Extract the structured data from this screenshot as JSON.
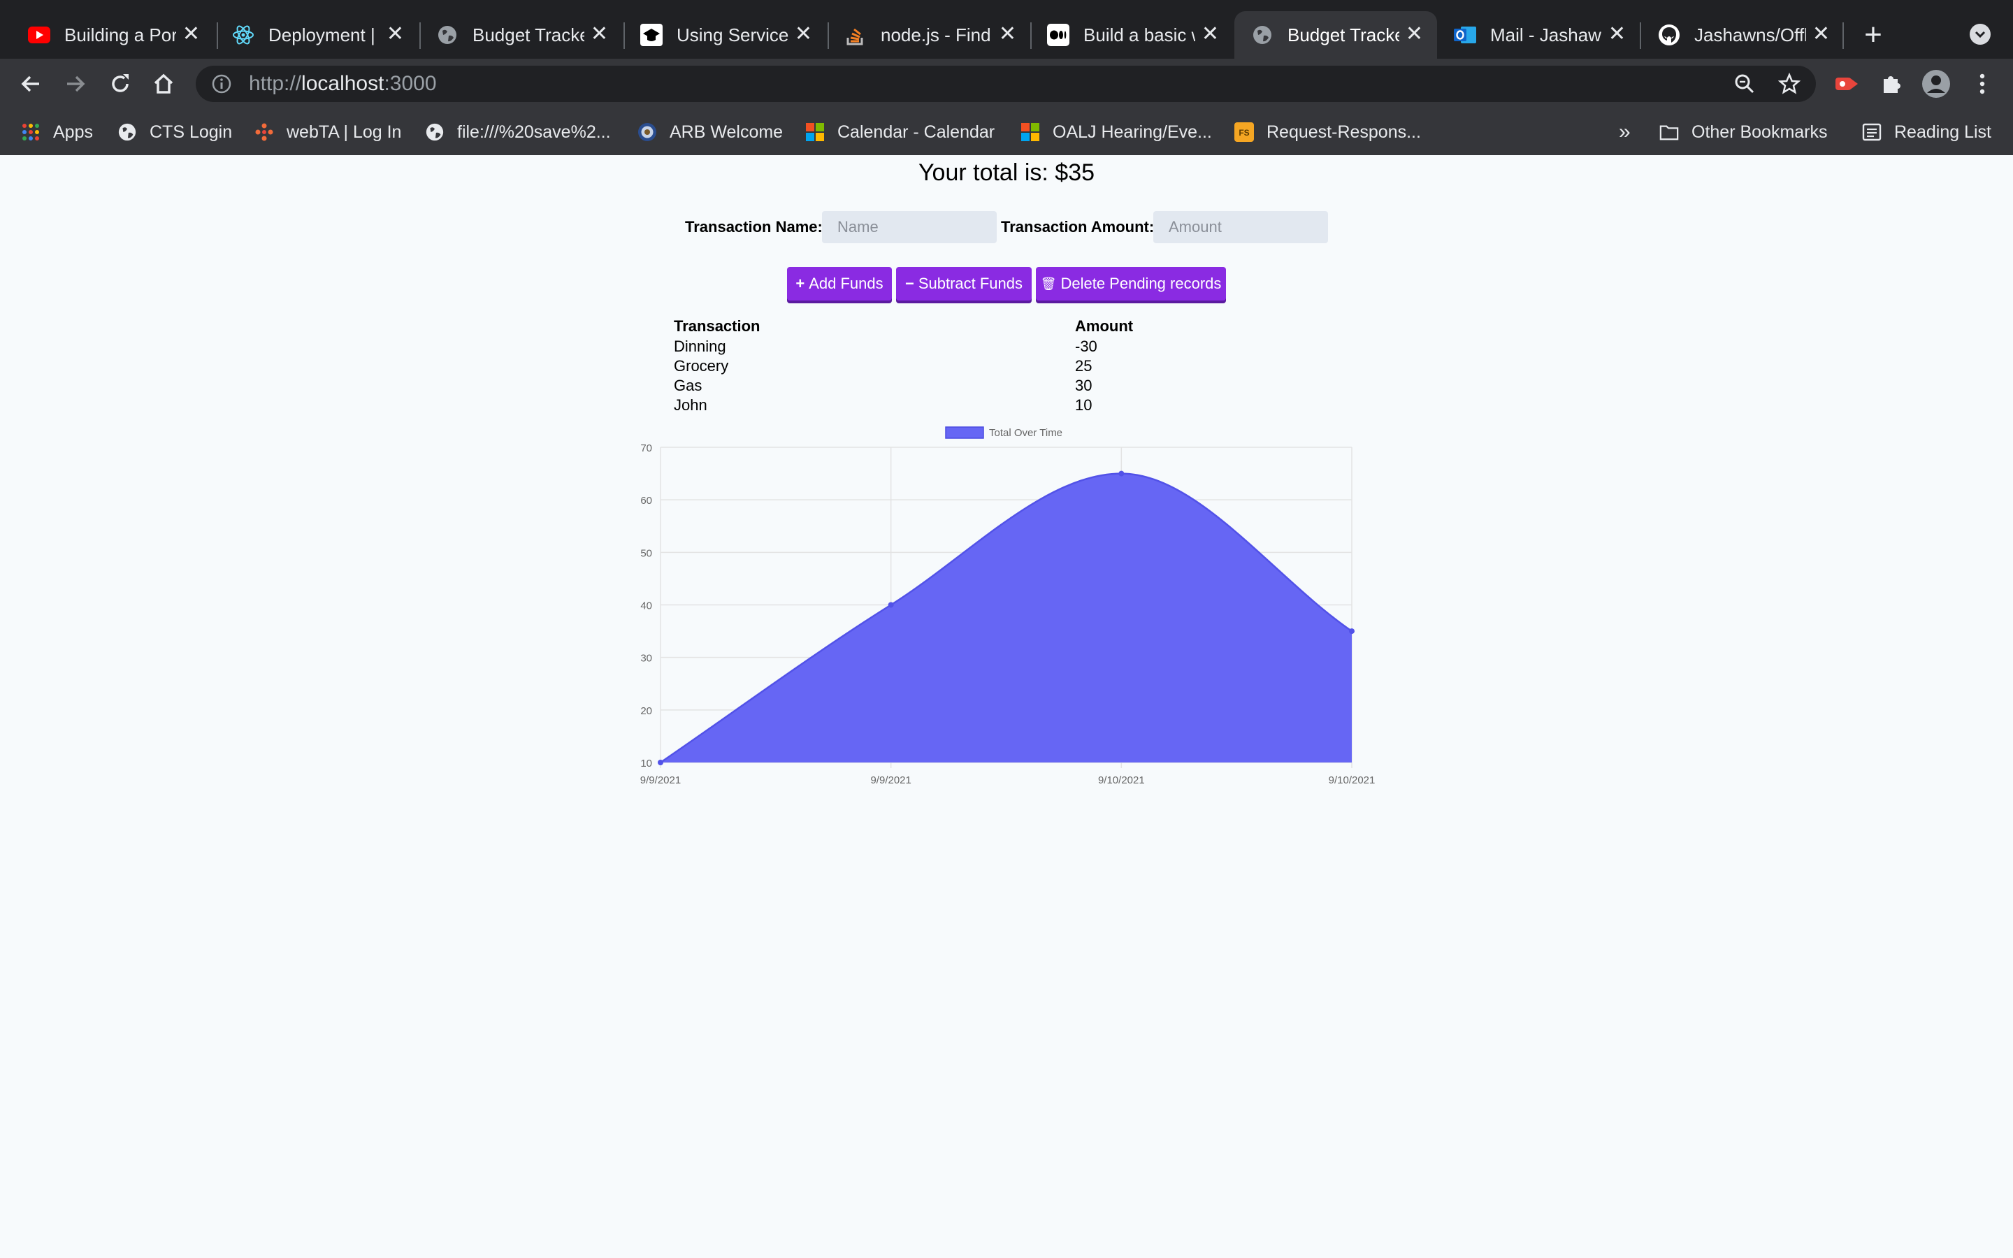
{
  "browser": {
    "tabs": [
      {
        "title": "Building a Port",
        "icon": "youtube-icon"
      },
      {
        "title": "Deployment | C",
        "icon": "react-icon"
      },
      {
        "title": "Budget Tracke",
        "icon": "globe-icon"
      },
      {
        "title": "Using Service",
        "icon": "graduation-cap-icon"
      },
      {
        "title": "node.js - Find",
        "icon": "stackoverflow-icon"
      },
      {
        "title": "Build a basic w",
        "icon": "medium-icon"
      },
      {
        "title": "Budget Tracke",
        "icon": "globe-icon",
        "active": true
      },
      {
        "title": "Mail - Jashawn",
        "icon": "outlook-icon"
      },
      {
        "title": "Jashawns/Offl",
        "icon": "github-icon"
      }
    ],
    "close_glyph": "✕",
    "new_tab_glyph": "+",
    "url_scheme": "http://",
    "url_host": "localhost",
    "url_port": ":3000",
    "bookmarks": [
      {
        "label": "Apps",
        "icon": "apps-grid-icon"
      },
      {
        "label": "CTS Login",
        "icon": "globe-icon"
      },
      {
        "label": "webTA | Log In",
        "icon": "webta-icon"
      },
      {
        "label": "file:///%20save%2...",
        "icon": "globe-icon"
      },
      {
        "label": "ARB Welcome",
        "icon": "seal-icon"
      },
      {
        "label": "Calendar - Calendar",
        "icon": "microsoft-icon"
      },
      {
        "label": "OALJ Hearing/Eve...",
        "icon": "microsoft-icon"
      },
      {
        "label": "Request-Respons...",
        "icon": "fs-icon"
      }
    ],
    "bookmarks_overflow": "»",
    "other_bookmarks": "Other Bookmarks",
    "reading_list": "Reading List",
    "colors": {
      "frame": "#202124",
      "toolbar": "#35363a",
      "text": "#e8eaed"
    }
  },
  "app": {
    "total_text": "Your total is: $35",
    "name_label": "Transaction Name:",
    "name_placeholder": "Name",
    "amount_label": "Transaction Amount:",
    "amount_placeholder": "Amount",
    "buttons": {
      "add": {
        "icon": "plus-icon",
        "glyph": "+",
        "label": "Add Funds"
      },
      "subtract": {
        "icon": "minus-icon",
        "glyph": "−",
        "label": "Subtract Funds"
      },
      "delete": {
        "icon": "trash-icon",
        "glyph": "🗑",
        "label": "Delete Pending records"
      }
    },
    "table": {
      "headers": [
        "Transaction",
        "Amount"
      ],
      "rows": [
        [
          "Dinning",
          "-30"
        ],
        [
          "Grocery",
          "25"
        ],
        [
          "Gas",
          "30"
        ],
        [
          "John",
          "10"
        ]
      ]
    },
    "colors": {
      "button": "#8a2be2",
      "input_bg": "#e2e8f0",
      "page_bg": "#f7fafc",
      "chart_fill": "#6666f4"
    }
  },
  "chart_data": {
    "type": "area",
    "categories": [
      "9/9/2021",
      "9/9/2021",
      "9/10/2021",
      "9/10/2021"
    ],
    "series": [
      {
        "name": "Total Over Time",
        "values": [
          10,
          40,
          65,
          35
        ]
      }
    ],
    "ylim": [
      10,
      70
    ],
    "yticks": [
      10,
      20,
      30,
      40,
      50,
      60,
      70
    ],
    "grid": true,
    "legend": "top",
    "smooth": true
  }
}
